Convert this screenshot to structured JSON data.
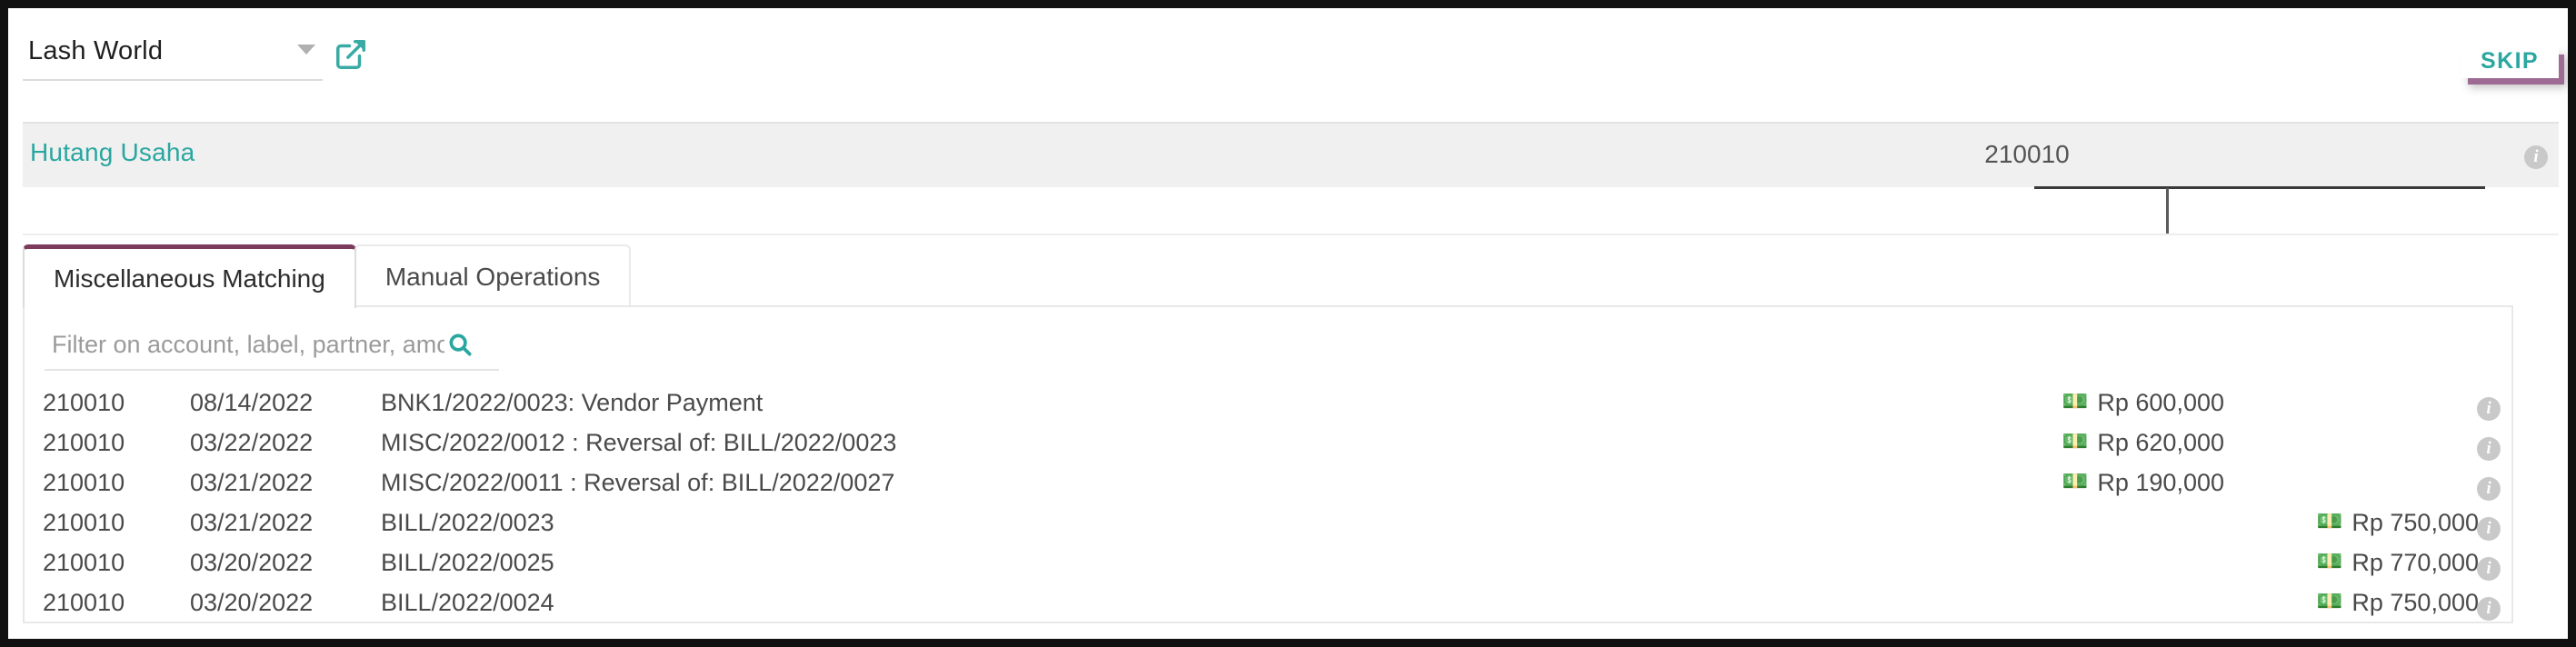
{
  "topbar": {
    "company": "Lash World",
    "dropdown_icon": "chevron-down-icon",
    "external_link_icon": "external-link-icon",
    "skip_label": "SKIP"
  },
  "account_header": {
    "name": "Hutang Usaha",
    "code": "210010",
    "info_icon": "info-icon"
  },
  "tabs": [
    {
      "label": "Miscellaneous Matching",
      "active": true
    },
    {
      "label": "Manual Operations",
      "active": false
    }
  ],
  "filter": {
    "placeholder": "Filter on account, label, partner, amount,...",
    "value": "",
    "search_icon": "search-icon"
  },
  "table": {
    "money_icon": "banknote-icon",
    "info_icon": "info-icon",
    "rows": [
      {
        "account": "210010",
        "date": "08/14/2022",
        "label": "BNK1/2022/0023: Vendor Payment",
        "debit": "Rp 600,000",
        "credit": ""
      },
      {
        "account": "210010",
        "date": "03/22/2022",
        "label": "MISC/2022/0012 : Reversal of: BILL/2022/0023",
        "debit": "Rp 620,000",
        "credit": ""
      },
      {
        "account": "210010",
        "date": "03/21/2022",
        "label": "MISC/2022/0011 : Reversal of: BILL/2022/0027",
        "debit": "Rp 190,000",
        "credit": ""
      },
      {
        "account": "210010",
        "date": "03/21/2022",
        "label": "BILL/2022/0023",
        "debit": "",
        "credit": "Rp 750,000"
      },
      {
        "account": "210010",
        "date": "03/20/2022",
        "label": "BILL/2022/0025",
        "debit": "",
        "credit": "Rp 770,000"
      },
      {
        "account": "210010",
        "date": "03/20/2022",
        "label": "BILL/2022/0024",
        "debit": "",
        "credit": "Rp 750,000"
      }
    ]
  },
  "colors": {
    "accent_teal": "#2aa7a0",
    "tab_active_border": "#7c3a5d",
    "skip_shadow": "#9d6b94",
    "money_green": "#4fd06a",
    "strip_bg": "#f0f0f0"
  }
}
